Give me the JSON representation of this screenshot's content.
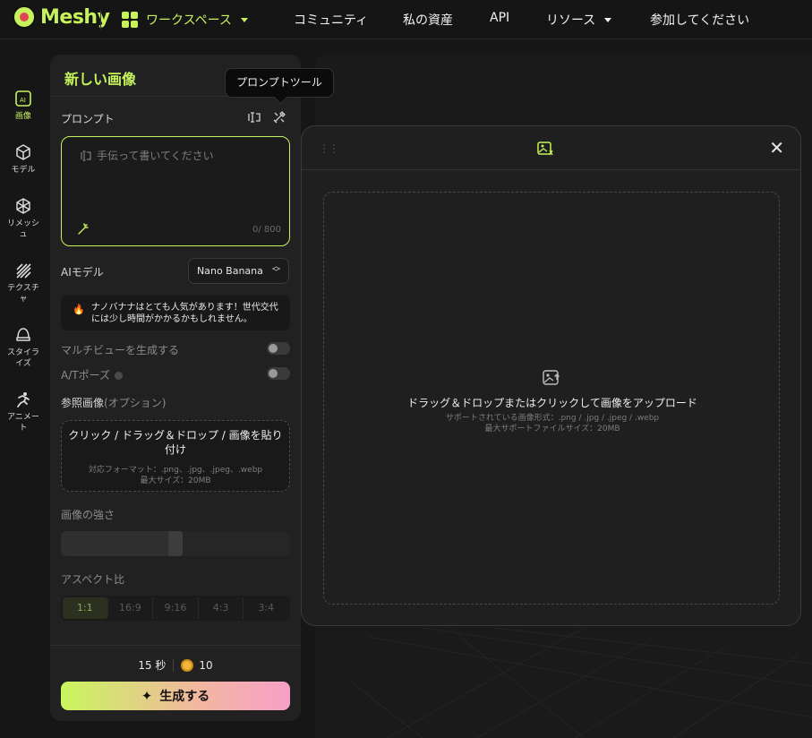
{
  "brand": {
    "name": "Meshy"
  },
  "nav": {
    "workspace": "ワークスペース",
    "community": "コミュニティ",
    "assets": "私の資産",
    "api": "API",
    "resources": "リソース",
    "join": "参加してください"
  },
  "rail": [
    {
      "label": "画像",
      "icon": "image-ai-icon"
    },
    {
      "label": "モデル",
      "icon": "cube-icon"
    },
    {
      "label": "リメッシュ",
      "icon": "remesh-icon"
    },
    {
      "label": "テクスチャ",
      "icon": "texture-icon"
    },
    {
      "label": "スタイライズ",
      "icon": "stylize-icon"
    },
    {
      "label": "アニメート",
      "icon": "animate-icon"
    }
  ],
  "panel": {
    "title": "新しい画像",
    "prompt_label": "プロンプト",
    "prompt_placeholder": "手伝って書いてください",
    "prompt_count": "0/ 800",
    "model_label": "AIモデル",
    "model_value": "Nano Banana",
    "notice": "ナノバナナはとても人気があります！世代交代には少し時間がかかるかもしれません。",
    "multiview_label": "マルチビューを生成する",
    "multiview_on": false,
    "tpose_label": "A/Tポーズ",
    "tpose_on": false,
    "ref_label": "参照画像",
    "ref_optional": "(オプション)",
    "ref_title": "クリック / ドラッグ＆ドロップ / 画像を貼り付け",
    "ref_formats": "対応フォーマット：.png、.jpg、.jpeg、.webp",
    "ref_maxsize": "最大サイズ：20MB",
    "strength_label": "画像の強さ",
    "strength_value": 0.5,
    "aspect_label": "アスペクト比",
    "aspect_options": [
      "1:1",
      "16:9",
      "9:16",
      "4:3",
      "3:4"
    ],
    "aspect_selected": "1:1",
    "time": "15 秒",
    "credits": "10",
    "generate": "生成する"
  },
  "tooltip": "プロンプトツール",
  "upload": {
    "title": "ドラッグ＆ドロップまたはクリックして画像をアップロード",
    "formats": "サポートされている画像形式：.png / .jpg / .jpeg / .webp",
    "maxsize": "最大サポートファイルサイズ：20MB"
  },
  "colors": {
    "accent": "#c6f35c",
    "bg": "#161616",
    "panel": "#212121"
  }
}
